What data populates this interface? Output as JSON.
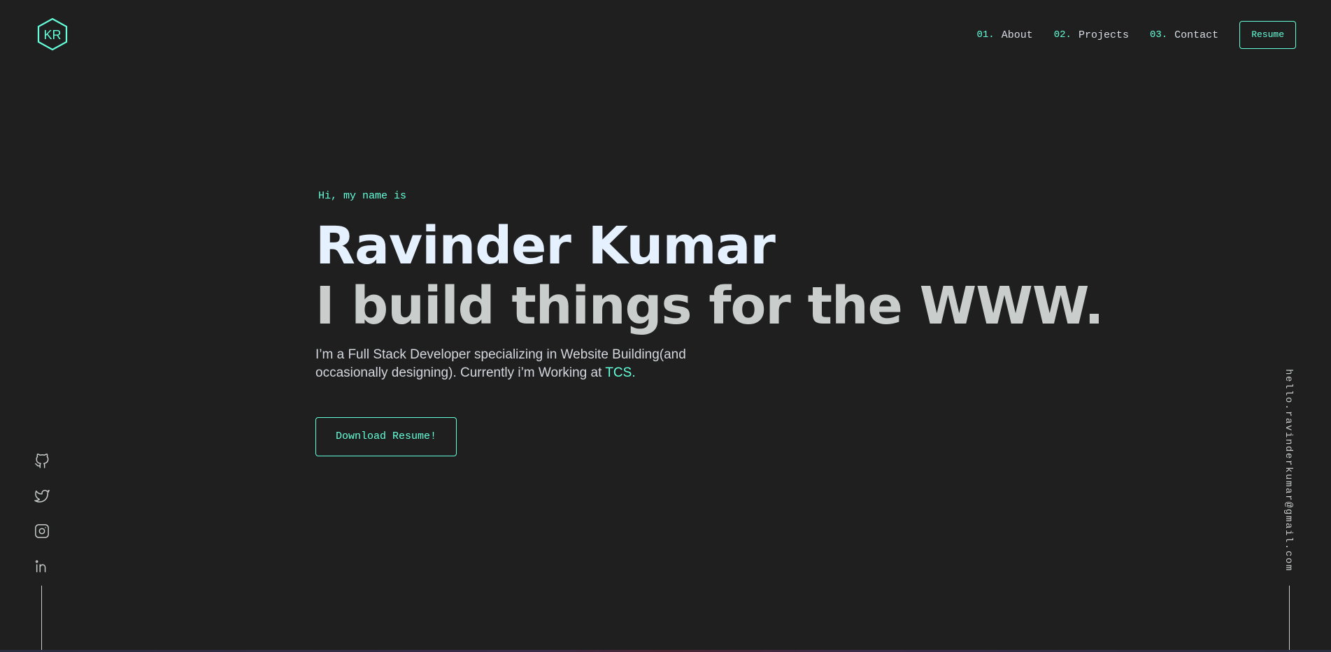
{
  "logo": {
    "text": "KR",
    "icon": "hexagon-logo-icon"
  },
  "nav": {
    "items": [
      {
        "num": "01.",
        "label": "About"
      },
      {
        "num": "02.",
        "label": "Projects"
      },
      {
        "num": "03.",
        "label": "Contact"
      }
    ],
    "resume_label": "Resume"
  },
  "hero": {
    "greeting": "Hi, my name is",
    "name": "Ravinder Kumar",
    "tagline": "I build things for the WWW.",
    "intro_text": "I’m a Full Stack Developer specializing in Website Building(and occasionally designing). Currently i’m Working at ",
    "company": "TCS.",
    "cta_label": "Download Resume!"
  },
  "socials": [
    "github-icon",
    "twitter-icon",
    "instagram-icon",
    "linkedin-icon"
  ],
  "email": "hello.ravinderkumar@gmail.com",
  "colors": {
    "background": "#1f1f1f",
    "accent": "#64ffda",
    "heading": "#e6f1ff",
    "subheading": "#c9cdcc"
  }
}
